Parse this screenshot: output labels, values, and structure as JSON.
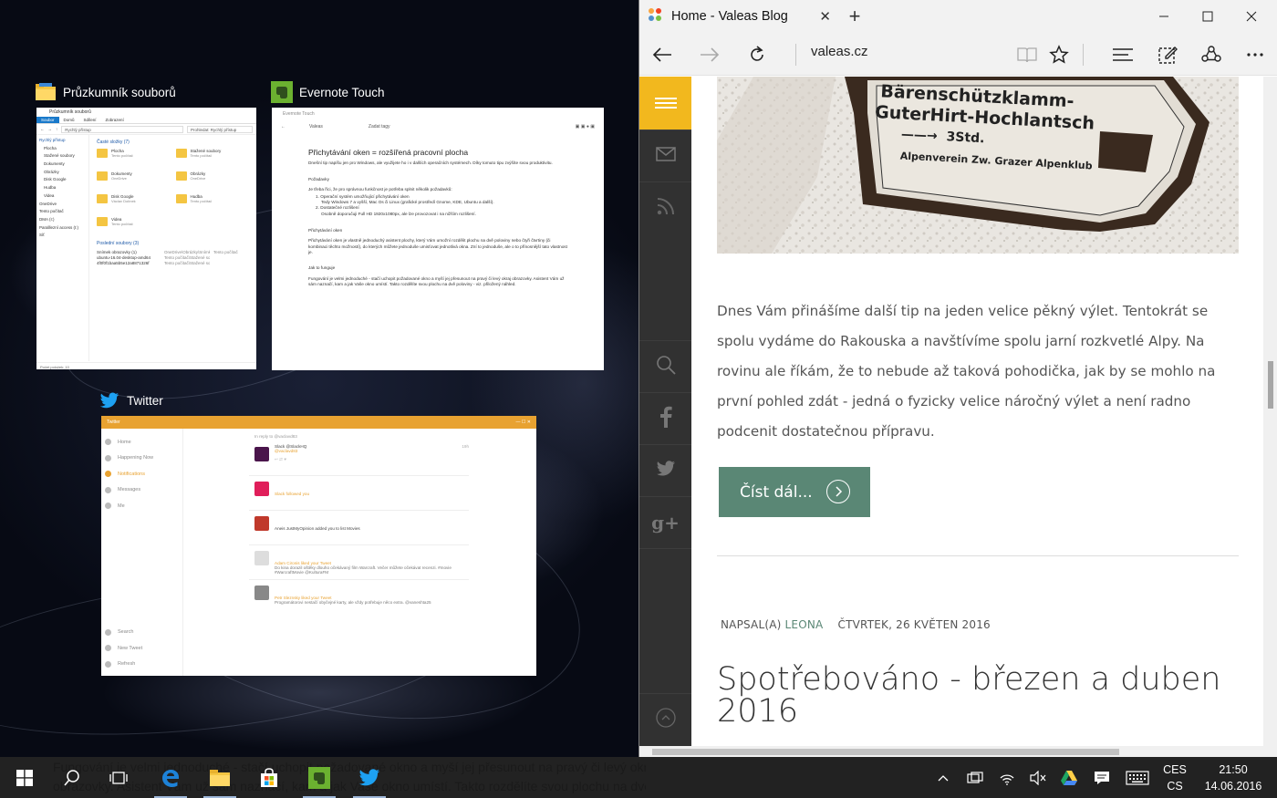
{
  "snap_assist": {
    "explorer": {
      "title": "Průzkumník souborů",
      "window_title": "Průzkumník souborů",
      "ribbon": [
        "Soubor",
        "Domů",
        "Sdílení",
        "Zobrazení"
      ],
      "address": "Rychlý přístup",
      "search_placeholder": "Prohledat: Rychlý přístup",
      "nav": [
        "Rychlý přístup",
        "Plocha",
        "Stažené soubory",
        "Dokumenty",
        "Obrázky",
        "Disk Google",
        "Hudba",
        "Videa",
        "OneDrive",
        "Tento počítač",
        "DMA (I:)",
        "Paralllezní access (I:)",
        "Síť"
      ],
      "section_frequent": "Časté složky (7)",
      "folders": [
        {
          "name": "Plocha",
          "sub": "Tento počítač"
        },
        {
          "name": "Stažené soubory",
          "sub": "Tento počítač"
        },
        {
          "name": "Dokumenty",
          "sub": "OneDrive"
        },
        {
          "name": "Obrázky",
          "sub": "OneDrive"
        },
        {
          "name": "Disk Google",
          "sub": "Václav Dolínek"
        },
        {
          "name": "Hudba",
          "sub": "Tento počítač"
        },
        {
          "name": "Videa",
          "sub": "Tento počítač"
        }
      ],
      "section_recent": "Poslední soubory (3)",
      "recent": [
        [
          "Snímek obrazovky (1)",
          "OneDrive\\Obrázky\\Snímky obrazovky",
          "Tento počítač"
        ],
        [
          "ubuntu-16.04-desktop-amd64",
          "Tento počítač\\Stažené soubory",
          ""
        ],
        [
          "4f0f0f1baa5b5e12a8871326f",
          "Tento počítač\\Stažené soubory",
          ""
        ]
      ],
      "status": "Počet položek: 10"
    },
    "evernote": {
      "title": "Evernote Touch",
      "window_title": "Evernote Touch",
      "notebook": "Valeas",
      "tags": "Zadat tagy",
      "heading": "Přichytávání oken = rozšířená pracovní plocha",
      "intro": "Dnešní tip napíšu jen pro Windows, ale využijete ho i v dalších operačních systémech. Díky tomuto tipu zvýšíte svou produktivitu.",
      "req_head": "Požadavky",
      "req_text": "Je třeba říci, že pro správnou funkčnost je potřeba splnit několik požadavků:",
      "req_1": "1. Operační systém umožňující přichytávání oken",
      "req_1b": "Tedy Windows 7 a vyšší, Mac Os či Linux (grafické prostředí Gnome, KDE, Ubuntu a další).",
      "req_2": "2. Dostatečné rozlišení",
      "req_2b": "Osobně doporučuji Full HD 1920x1080px, ale lze provozovat i na nižším rozlišení.",
      "snap_head": "Přichytávání oken",
      "snap_text": "Přichytávání oken je vlastně jednoduchý asistent plochy, který Vám umožní rozdělit plochu na dvě poloviny nebo čtyři čtvrtiny (či kombinaci těchto možností), do kterých můžete jednoduše umisťovat jednotlivá okna. Zní to jednoduše, ale o to přínosnější tato vlastnost je.",
      "how_head": "Jak to funguje",
      "how_text": "Fungování je velmi jednoduché - stačí uchopit požadované okno a myší jej přesunout na pravý či levý okraj obrazovky. Asistent Vám už sám naznačí, kam a jak Vaše okno umístí. Takto rozdělíte svou plochu na dvě poloviny - viz. přiložený náhled."
    },
    "twitter": {
      "title": "Twitter",
      "window_title": "Twitter",
      "nav": [
        "Home",
        "Happening Now",
        "Notifications",
        "Messages",
        "Me"
      ],
      "nav_bottom": [
        "Search",
        "New Tweet",
        "Refresh"
      ],
      "reply_to": "In reply to @vaclavd83",
      "items": [
        {
          "line1": "Slack @SlackHQ",
          "line2": "@vaclavd83",
          "time": "19h",
          "color": "#4a154b"
        },
        {
          "line1": "",
          "line2": "Slack followed you",
          "color": "#e01e5a"
        },
        {
          "line1": "",
          "line2": "Aneis JustMyOpinion added you to list Movies",
          "color": "#c0392b"
        },
        {
          "line1": "Adam Cironis liked your Tweet",
          "line2": "Do kina dorazil oštěky dlouho očekávaný film Warcraft. Večer můžete očekávat recenzi. #movie #WarcraftMovie @KulturaFM",
          "color": "#999999"
        },
        {
          "line1": "Petr Sleznsky liked your Tweet",
          "line2": "Programátorovi nestačí obyčejné karty, ale vždy potřebuje něco extra. @vaneshta25",
          "color": "#777777"
        }
      ]
    }
  },
  "browser": {
    "tab_title": "Home - Valeas Blog",
    "address": "valeas.cz",
    "article_text": "Dnes Vám přinášíme další tip na jeden velice pěkný výlet. Tentokrát se spolu vydáme do Rakouska a navštívíme spolu jarní rozkvetlé Alpy. Na rovinu ale říkám, že to nebude až taková pohodička, jak by se mohlo na první pohled zdát - jedná o fyzicky velice náročný výlet a není radno podcenit dostatečnou přípravu.",
    "read_more": "Číst dál...",
    "meta_prefix": "NAPSAL(A)",
    "meta_author": "LEONA",
    "meta_date": "ČTVRTEK, 26 KVĚTEN 2016",
    "post_title": "Spotřebováno - březen a duben 2016",
    "sign": {
      "line1": "Bärenschützklamm-",
      "line2": "GuterHirt-Hochlantsch",
      "line3": "3Std.",
      "line4": "Alpenverein Zw. Grazer Alpenklub"
    },
    "accent": "#f2b81e",
    "button_color": "#5a8775"
  },
  "taskbar": {
    "behind_line1": "Fungování je velmi jednoduché - stačí uchopit požadované okno a myší jej přesunout na pravý či levý okraj",
    "behind_line2": "obrazovky. Asistent Vám už sám naznačí, kam a jak Vaše okno umístí. Takto rozdělíte svou plochu na dvě",
    "lang_1": "CES",
    "lang_2": "CS",
    "time": "21:50",
    "date": "14.06.2016"
  }
}
